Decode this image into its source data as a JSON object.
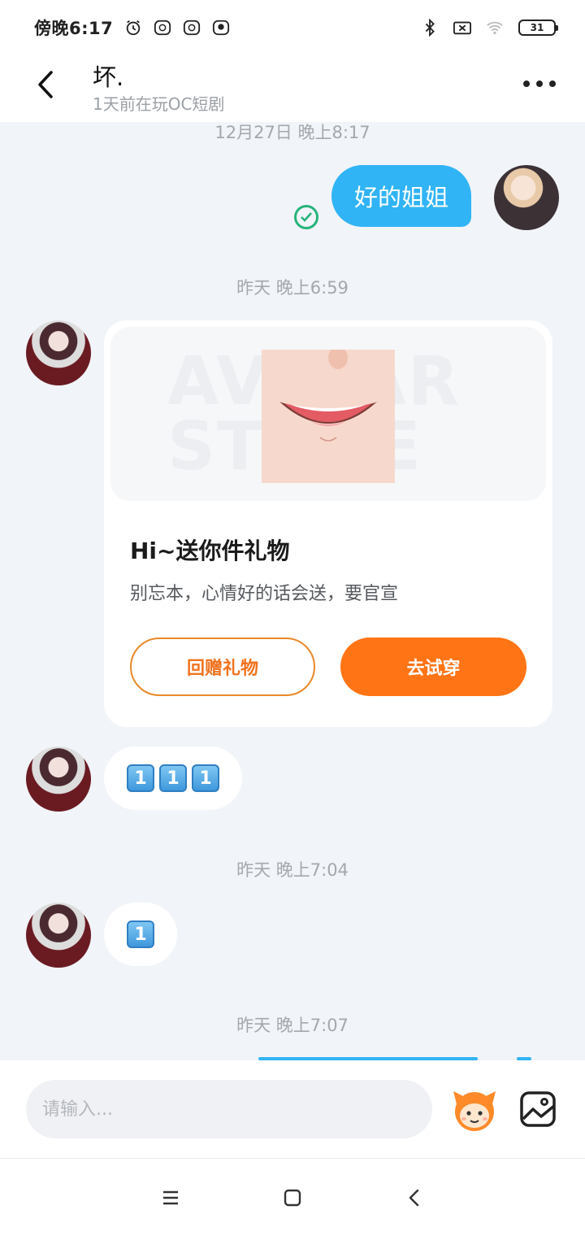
{
  "status_bar": {
    "time": "傍晚6:17",
    "battery": "31"
  },
  "header": {
    "title": "坏.",
    "subtitle": "1天前在玩OC短剧"
  },
  "timestamps": {
    "t1": "12月27日 晚上8:17",
    "t2": "昨天 晚上6:59",
    "t3": "昨天 晚上7:04",
    "t4": "昨天 晚上7:07"
  },
  "messages": {
    "self_text": "好的姐姐",
    "gift_card": {
      "watermark": "AVATAR STORE",
      "title": "Hi~送你件礼物",
      "description": "别忘本，心情好的话会送，要官宣",
      "return_gift_button": "回赠礼物",
      "try_on_button": "去试穿"
    },
    "keycaps_1": [
      "1",
      "1",
      "1"
    ],
    "keycaps_2": [
      "1"
    ]
  },
  "input": {
    "placeholder": "请输入..."
  },
  "colors": {
    "self_bubble": "#31b4f5",
    "accent_orange": "#ff7415",
    "read_check": "#27b37a"
  },
  "icons": [
    "alarm-icon",
    "app-notif-icon",
    "bluetooth-icon",
    "sim-icon",
    "wifi-icon",
    "battery-icon",
    "back-arrow-icon",
    "more-icon",
    "read-check-icon",
    "emoji-mascot-icon",
    "image-icon",
    "menu-icon",
    "home-icon",
    "nav-back-icon"
  ]
}
